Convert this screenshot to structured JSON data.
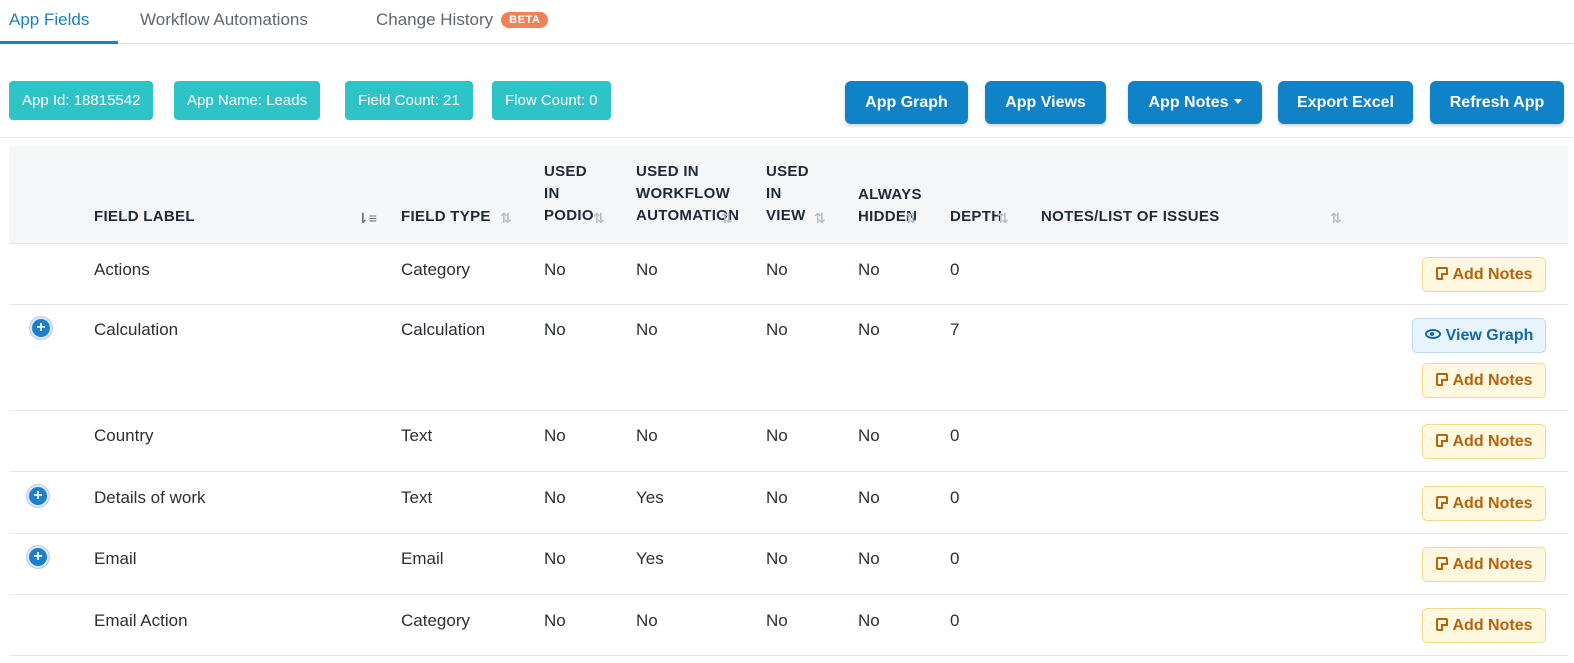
{
  "tabs": [
    {
      "label": "App Fields",
      "active": true
    },
    {
      "label": "Workflow Automations",
      "active": false
    },
    {
      "label": "Change History",
      "active": false,
      "badge": "BETA"
    }
  ],
  "info": {
    "app_id": "App Id: 18815542",
    "app_name": "App Name: Leads",
    "field_count": "Field Count: 21",
    "flow_count": "Flow Count: 0"
  },
  "actions": {
    "app_graph": "App Graph",
    "app_views": "App Views",
    "app_notes": "App Notes",
    "export_excel": "Export Excel",
    "refresh_app": "Refresh App"
  },
  "columns": {
    "field_label": "FIELD LABEL",
    "field_type": "FIELD TYPE",
    "used_in_podio_1": "USED",
    "used_in_podio_2": "IN",
    "used_in_podio_3": "PODIO",
    "used_in_wf_1": "USED IN",
    "used_in_wf_2": "WORKFLOW",
    "used_in_wf_3": "AUTOMATION",
    "used_in_view_1": "USED",
    "used_in_view_2": "IN",
    "used_in_view_3": "VIEW",
    "always_hidden_1": "ALWAYS",
    "always_hidden_2": "HIDDEN",
    "depth": "DEPTH",
    "notes": "NOTES/LIST OF ISSUES"
  },
  "row_buttons": {
    "add_notes": "Add Notes",
    "view_graph": "View Graph"
  },
  "rows": [
    {
      "label": "Actions",
      "type": "Category",
      "podio": "No",
      "workflow": "No",
      "view": "No",
      "hidden": "No",
      "depth": "0"
    },
    {
      "label": "Calculation",
      "type": "Calculation",
      "podio": "No",
      "workflow": "No",
      "view": "No",
      "hidden": "No",
      "depth": "7"
    },
    {
      "label": "Country",
      "type": "Text",
      "podio": "No",
      "workflow": "No",
      "view": "No",
      "hidden": "No",
      "depth": "0"
    },
    {
      "label": "Details of work",
      "type": "Text",
      "podio": "No",
      "workflow": "Yes",
      "view": "No",
      "hidden": "No",
      "depth": "0"
    },
    {
      "label": "Email",
      "type": "Email",
      "podio": "No",
      "workflow": "Yes",
      "view": "No",
      "hidden": "No",
      "depth": "0"
    },
    {
      "label": "Email Action",
      "type": "Category",
      "podio": "No",
      "workflow": "No",
      "view": "No",
      "hidden": "No",
      "depth": "0"
    }
  ],
  "colors": {
    "primary": "#0f82c8",
    "chip": "#2ec3c7",
    "beta": "#f08158",
    "notes_text": "#b8620a"
  },
  "icons": {
    "expand": "plus-circle-icon",
    "notes": "note-icon",
    "graph": "eye-icon",
    "sort": "sort-icon"
  }
}
